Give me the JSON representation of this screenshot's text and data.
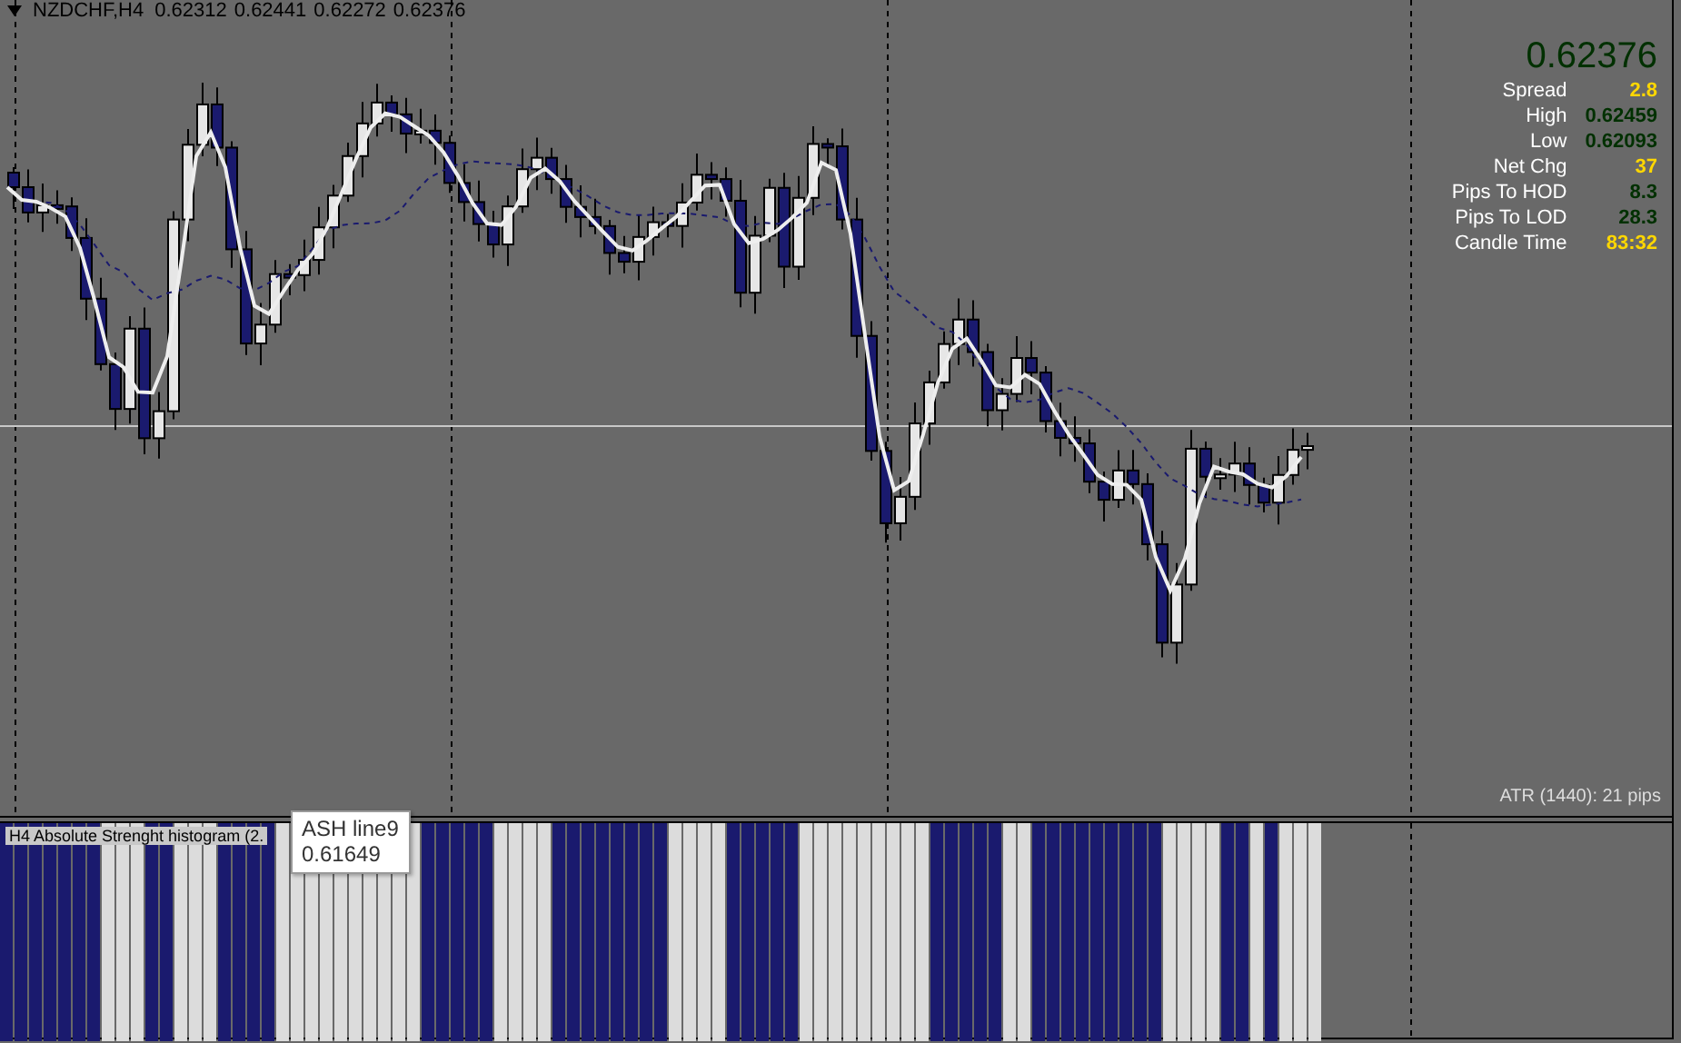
{
  "chart": {
    "symbol": "NZDCHF,H4",
    "ohlc": [
      "0.62312",
      "0.62441",
      "0.62272",
      "0.62376"
    ]
  },
  "info_panel": {
    "price": "0.62376",
    "rows": [
      {
        "label": "Spread",
        "value": "2.8",
        "color": "#ffd700"
      },
      {
        "label": "High",
        "value": "0.62459",
        "color": "#003000"
      },
      {
        "label": "Low",
        "value": "0.62093",
        "color": "#003000"
      },
      {
        "label": "Net Chg",
        "value": "37",
        "color": "#ffd700"
      },
      {
        "label": "Pips To HOD",
        "value": "8.3",
        "color": "#003000"
      },
      {
        "label": "Pips To LOD",
        "value": "28.3",
        "color": "#003000"
      },
      {
        "label": "Candle Time",
        "value": "83:32",
        "color": "#ffd700"
      }
    ]
  },
  "atr_label": "ATR (1440): 21 pips",
  "indicator": {
    "label": "H4 Absolute Strenght histogram (2.",
    "tooltip": {
      "title": "ASH line9",
      "value": "0.61649"
    }
  }
}
